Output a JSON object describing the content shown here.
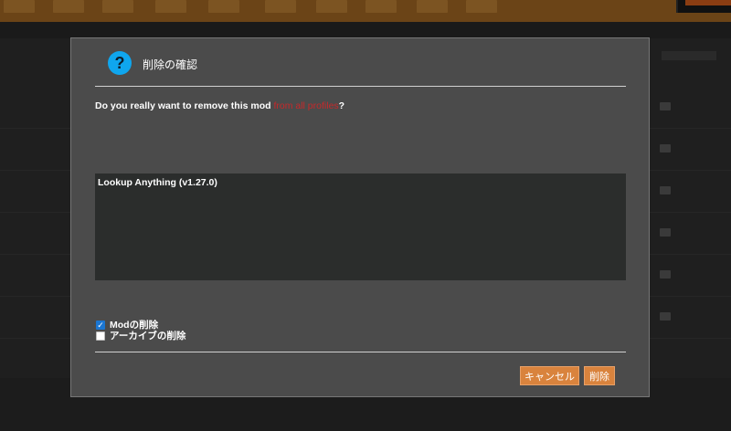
{
  "background": {
    "rows": [
      "",
      "",
      "",
      "",
      "",
      ""
    ]
  },
  "dialog": {
    "icon": "question-icon",
    "icon_glyph": "?",
    "title": "削除の確認",
    "question_prefix": "Do you really want to remove this mod",
    "question_highlight": "from all profiles",
    "question_suffix": "?",
    "mods": [
      "Lookup Anything (v1.27.0)"
    ],
    "options": [
      {
        "label": "Modの削除",
        "checked": true
      },
      {
        "label": "アーカイブの削除",
        "checked": false
      }
    ],
    "cancel_label": "キャンセル",
    "delete_label": "削除"
  },
  "colors": {
    "accent": "#d9833d",
    "dialog_bg": "#4b4b4b",
    "icon_blue": "#0fa6ee",
    "highlight_red": "#c7282a",
    "checkbox_blue": "#1b76d2"
  }
}
